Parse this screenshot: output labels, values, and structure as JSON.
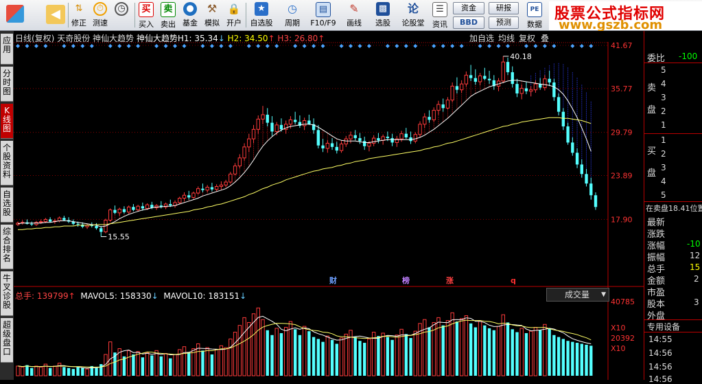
{
  "toolbar": {
    "buttons": [
      {
        "id": "back",
        "label": "",
        "icon": "back-arrow-icon"
      },
      {
        "id": "fix",
        "label": "修正",
        "icon": "up-down-arrow-icon"
      },
      {
        "id": "test",
        "label": "测速",
        "icon": "speed-icon"
      },
      {
        "id": "buy",
        "label": "买入",
        "icon": "buy-icon",
        "glyph": "买"
      },
      {
        "id": "sell",
        "label": "卖出",
        "icon": "sell-icon",
        "glyph": "卖"
      },
      {
        "id": "fund",
        "label": "基金",
        "icon": "fund-icon"
      },
      {
        "id": "sim",
        "label": "模拟",
        "icon": "hammer-icon"
      },
      {
        "id": "open",
        "label": "开户",
        "icon": "lock-icon"
      },
      {
        "id": "watch",
        "label": "自选股",
        "icon": "star-icon"
      },
      {
        "id": "period",
        "label": "周期",
        "icon": "clock-icon"
      },
      {
        "id": "f10",
        "label": "F10/F9",
        "icon": "f10-icon"
      },
      {
        "id": "draw",
        "label": "画线",
        "icon": "pencil-icon"
      },
      {
        "id": "pick",
        "label": "选股",
        "icon": "monitor-icon"
      },
      {
        "id": "forum",
        "label": "论股堂",
        "icon": "forum-icon",
        "glyph": "论"
      },
      {
        "id": "news",
        "label": "资讯",
        "icon": "news-icon"
      },
      {
        "id": "data",
        "label": "数据",
        "icon": "pe-icon",
        "glyph": "PE"
      }
    ],
    "small": {
      "funds": "资金",
      "bbd": "BBD",
      "research": "研报",
      "forecast": "预测"
    }
  },
  "brand": {
    "title": "股票公式指标网",
    "url": "www.gszb.com"
  },
  "left_tabs": [
    {
      "label": "应用",
      "active": false
    },
    {
      "label": "分时图",
      "active": false
    },
    {
      "label": "K线图",
      "active": true
    },
    {
      "label": "个股资料",
      "active": false
    },
    {
      "label": "自选股",
      "active": false
    },
    {
      "label": "综合排名",
      "active": false
    },
    {
      "label": "牛叉诊股",
      "active": false
    },
    {
      "label": "超级盘口",
      "active": false
    }
  ],
  "chart_head": {
    "period": "日线(复权)",
    "stock": "天奇股份",
    "indicator": "神仙大趋势",
    "h1_label": "神仙大趋势H1: 35.34",
    "h2_label": "H2: 34.50",
    "h3_label": "H3: 26.80",
    "tabs": [
      "加自选",
      "均线",
      "复权",
      "叠"
    ],
    "colors": {
      "h1": "#ffffff",
      "h2": "#ffff00",
      "h3": "#ff4040"
    }
  },
  "price_axis": {
    "labels": [
      "41.67",
      "35.77",
      "29.79",
      "23.89",
      "17.90"
    ]
  },
  "annotations": {
    "high": "40.18",
    "low": "15.55",
    "events": [
      {
        "text": "财",
        "color": "#6ea0ff"
      },
      {
        "text": "榜",
        "color": "#c080ff"
      },
      {
        "text": "涨",
        "color": "#ff4040"
      },
      {
        "text": "q",
        "color": "#ff3030"
      }
    ]
  },
  "volume_head": {
    "total": "总手: 139799",
    "mavol5": "MAVOL5: 158330",
    "mavol10": "MAVOL10: 183151",
    "dropdown": "成交量"
  },
  "volume_axis": {
    "labels": [
      "40785",
      "X10",
      "20392",
      "X10"
    ]
  },
  "right_panel": {
    "weibi_label": "委比",
    "weibi_value": "-100",
    "sell_label": "卖盘",
    "buy_label": "买盘",
    "sell_levels": [
      "5",
      "4",
      "3",
      "2",
      "1"
    ],
    "buy_levels": [
      "1",
      "2",
      "3",
      "4",
      "5"
    ],
    "status": "在卖盘18.41位置",
    "fields": [
      "最新",
      "涨跌",
      "涨幅",
      "振幅",
      "总手",
      "金额",
      "市盈",
      "股本",
      "外盘"
    ],
    "field_values": [
      "",
      "",
      "-10",
      "12",
      "15",
      "2",
      "",
      "3",
      ""
    ],
    "device": "专用设备",
    "times": [
      "14:55",
      "14:56",
      "14:56",
      "14:56"
    ]
  },
  "chart_data": {
    "type": "candlestick",
    "y_range": [
      15.5,
      41.67
    ],
    "candles": [
      [
        17.2,
        17.6,
        17.0,
        17.4
      ],
      [
        17.4,
        17.8,
        17.2,
        17.5
      ],
      [
        17.5,
        17.9,
        17.2,
        17.3
      ],
      [
        17.3,
        17.6,
        17.0,
        17.2
      ],
      [
        17.2,
        17.7,
        17.0,
        17.5
      ],
      [
        17.5,
        17.9,
        17.3,
        17.6
      ],
      [
        17.6,
        18.1,
        17.4,
        17.9
      ],
      [
        17.9,
        18.2,
        17.5,
        17.6
      ],
      [
        17.6,
        18.0,
        17.3,
        17.7
      ],
      [
        17.7,
        18.3,
        17.5,
        18.1
      ],
      [
        18.1,
        18.4,
        17.7,
        17.8
      ],
      [
        17.8,
        18.2,
        17.4,
        17.6
      ],
      [
        17.6,
        17.9,
        17.1,
        17.3
      ],
      [
        17.3,
        17.6,
        16.9,
        17.2
      ],
      [
        17.2,
        17.5,
        16.7,
        16.9
      ],
      [
        16.9,
        17.3,
        16.6,
        17.1
      ],
      [
        17.1,
        17.5,
        16.8,
        17.0
      ],
      [
        17.0,
        17.4,
        16.5,
        16.7
      ],
      [
        16.7,
        17.0,
        15.55,
        16.2
      ],
      [
        16.2,
        18.0,
        16.0,
        17.8
      ],
      [
        17.8,
        19.4,
        17.6,
        19.2
      ],
      [
        19.2,
        19.8,
        18.6,
        18.8
      ],
      [
        18.8,
        19.5,
        18.4,
        19.3
      ],
      [
        19.3,
        19.7,
        18.7,
        18.9
      ],
      [
        18.9,
        19.8,
        18.7,
        19.6
      ],
      [
        19.6,
        20.0,
        19.0,
        19.2
      ],
      [
        19.2,
        19.9,
        19.0,
        19.7
      ],
      [
        19.7,
        20.2,
        19.1,
        19.4
      ],
      [
        19.4,
        20.1,
        19.2,
        19.9
      ],
      [
        19.9,
        20.3,
        19.3,
        19.5
      ],
      [
        19.5,
        20.0,
        19.2,
        19.8
      ],
      [
        19.8,
        20.4,
        19.4,
        19.6
      ],
      [
        19.6,
        20.2,
        19.3,
        20.0
      ],
      [
        20.0,
        20.6,
        19.6,
        19.8
      ],
      [
        19.8,
        20.5,
        19.5,
        20.2
      ],
      [
        20.2,
        21.0,
        20.0,
        20.8
      ],
      [
        20.8,
        21.6,
        20.4,
        21.2
      ],
      [
        21.2,
        21.8,
        20.6,
        20.9
      ],
      [
        20.9,
        21.7,
        20.7,
        21.5
      ],
      [
        21.5,
        22.4,
        21.3,
        22.1
      ],
      [
        22.1,
        22.8,
        21.6,
        21.9
      ],
      [
        21.9,
        22.6,
        21.6,
        22.3
      ],
      [
        22.3,
        22.9,
        21.7,
        22.0
      ],
      [
        22.0,
        22.7,
        21.8,
        22.4
      ],
      [
        22.4,
        23.1,
        22.0,
        22.6
      ],
      [
        22.6,
        23.3,
        22.3,
        23.0
      ],
      [
        23.0,
        24.4,
        22.8,
        24.1
      ],
      [
        24.1,
        25.6,
        23.9,
        25.2
      ],
      [
        25.2,
        26.8,
        24.9,
        26.3
      ],
      [
        26.3,
        28.3,
        25.9,
        27.8
      ],
      [
        27.8,
        29.6,
        27.1,
        28.9
      ],
      [
        28.9,
        30.8,
        28.3,
        30.2
      ],
      [
        30.2,
        32.1,
        29.6,
        31.6
      ],
      [
        31.6,
        33.4,
        30.9,
        32.2
      ],
      [
        32.2,
        33.1,
        30.6,
        31.1
      ],
      [
        31.1,
        32.0,
        29.3,
        29.9
      ],
      [
        29.9,
        31.2,
        29.4,
        30.8
      ],
      [
        30.8,
        31.7,
        29.9,
        30.2
      ],
      [
        30.2,
        31.4,
        29.6,
        30.9
      ],
      [
        30.9,
        32.0,
        30.3,
        31.5
      ],
      [
        31.5,
        32.6,
        30.9,
        31.2
      ],
      [
        31.2,
        32.1,
        30.4,
        30.7
      ],
      [
        30.7,
        31.8,
        30.1,
        31.4
      ],
      [
        31.4,
        32.2,
        30.8,
        30.9
      ],
      [
        30.9,
        31.7,
        29.6,
        30.1
      ],
      [
        30.1,
        30.8,
        27.6,
        28.0
      ],
      [
        28.0,
        28.9,
        27.1,
        27.6
      ],
      [
        27.6,
        28.7,
        27.0,
        28.3
      ],
      [
        28.3,
        29.0,
        27.4,
        27.8
      ],
      [
        27.8,
        28.5,
        26.9,
        27.3
      ],
      [
        27.3,
        28.6,
        27.0,
        28.2
      ],
      [
        28.2,
        29.3,
        27.8,
        28.9
      ],
      [
        28.9,
        29.9,
        28.3,
        29.4
      ],
      [
        29.4,
        30.1,
        28.7,
        29.0
      ],
      [
        29.0,
        29.7,
        28.2,
        28.6
      ],
      [
        28.6,
        29.2,
        27.4,
        27.9
      ],
      [
        27.9,
        28.6,
        27.2,
        28.3
      ],
      [
        28.3,
        29.4,
        27.9,
        29.0
      ],
      [
        29.0,
        29.7,
        28.3,
        28.7
      ],
      [
        28.7,
        29.5,
        28.1,
        29.2
      ],
      [
        29.2,
        29.9,
        28.6,
        29.0
      ],
      [
        29.0,
        29.6,
        27.9,
        28.4
      ],
      [
        28.4,
        29.3,
        27.8,
        28.9
      ],
      [
        28.9,
        30.0,
        28.5,
        29.6
      ],
      [
        29.6,
        30.4,
        28.9,
        29.1
      ],
      [
        29.1,
        29.9,
        28.2,
        28.6
      ],
      [
        28.6,
        29.8,
        28.3,
        29.5
      ],
      [
        29.5,
        31.3,
        29.1,
        30.9
      ],
      [
        30.9,
        32.4,
        30.4,
        31.9
      ],
      [
        31.9,
        32.8,
        31.1,
        31.5
      ],
      [
        31.5,
        33.2,
        31.2,
        32.8
      ],
      [
        32.8,
        34.1,
        32.2,
        33.6
      ],
      [
        33.6,
        34.4,
        32.6,
        33.1
      ],
      [
        33.1,
        34.6,
        32.9,
        34.2
      ],
      [
        34.2,
        36.6,
        33.9,
        36.1
      ],
      [
        36.1,
        37.3,
        35.1,
        35.6
      ],
      [
        35.6,
        36.9,
        35.2,
        36.4
      ],
      [
        36.4,
        38.1,
        36.0,
        37.6
      ],
      [
        37.6,
        39.0,
        36.8,
        37.2
      ],
      [
        37.2,
        38.4,
        36.3,
        36.7
      ],
      [
        36.7,
        37.9,
        36.2,
        37.5
      ],
      [
        37.5,
        38.6,
        36.9,
        37.1
      ],
      [
        37.1,
        38.2,
        36.4,
        36.9
      ],
      [
        36.9,
        37.6,
        35.6,
        36.1
      ],
      [
        36.1,
        37.2,
        35.4,
        36.8
      ],
      [
        36.8,
        40.18,
        36.5,
        39.4
      ],
      [
        39.4,
        40.0,
        37.6,
        38.0
      ],
      [
        38.0,
        38.8,
        35.9,
        36.4
      ],
      [
        36.4,
        37.1,
        34.6,
        35.1
      ],
      [
        35.1,
        36.3,
        34.3,
        35.8
      ],
      [
        35.8,
        36.7,
        35.0,
        35.4
      ],
      [
        35.4,
        36.1,
        34.7,
        35.6
      ],
      [
        35.6,
        36.9,
        35.2,
        36.4
      ],
      [
        36.4,
        37.2,
        35.6,
        35.9
      ],
      [
        35.9,
        37.6,
        35.5,
        37.1
      ],
      [
        37.1,
        38.2,
        36.1,
        36.6
      ],
      [
        36.6,
        37.1,
        34.1,
        34.6
      ],
      [
        34.6,
        35.1,
        32.1,
        32.6
      ],
      [
        32.6,
        33.1,
        30.1,
        30.6
      ],
      [
        30.6,
        31.1,
        28.1,
        28.4
      ],
      [
        28.4,
        29.1,
        26.6,
        27.0
      ],
      [
        27.0,
        27.6,
        24.9,
        25.4
      ],
      [
        25.4,
        26.1,
        23.6,
        24.1
      ],
      [
        24.1,
        24.8,
        22.4,
        22.8
      ],
      [
        22.8,
        23.6,
        20.6,
        21.2
      ],
      [
        21.2,
        21.6,
        19.2,
        19.6
      ]
    ],
    "volumes": [
      10,
      9,
      11,
      8,
      10,
      9,
      12,
      8,
      10,
      13,
      9,
      8,
      7,
      9,
      8,
      7,
      10,
      8,
      12,
      22,
      35,
      24,
      28,
      20,
      26,
      22,
      25,
      19,
      24,
      21,
      26,
      20,
      23,
      18,
      22,
      27,
      30,
      24,
      28,
      33,
      26,
      29,
      22,
      27,
      31,
      29,
      38,
      45,
      52,
      60,
      55,
      64,
      70,
      58,
      47,
      42,
      49,
      44,
      50,
      56,
      48,
      42,
      51,
      46,
      40,
      38,
      35,
      41,
      37,
      33,
      39,
      43,
      47,
      40,
      36,
      34,
      38,
      45,
      41,
      44,
      40,
      37,
      42,
      48,
      43,
      39,
      46,
      54,
      58,
      50,
      55,
      60,
      52,
      57,
      65,
      56,
      59,
      62,
      54,
      50,
      56,
      52,
      49,
      47,
      51,
      63,
      55,
      48,
      45,
      49,
      44,
      46,
      50,
      47,
      53,
      49,
      42,
      40,
      38,
      36,
      35,
      34,
      33,
      32,
      31
    ],
    "ma_short": [
      17.3,
      17.4,
      17.4,
      17.4,
      17.4,
      17.4,
      17.5,
      17.5,
      17.6,
      17.7,
      17.7,
      17.7,
      17.6,
      17.5,
      17.4,
      17.3,
      17.2,
      17.1,
      16.9,
      17.0,
      17.3,
      17.6,
      18.0,
      18.3,
      18.6,
      18.8,
      19.0,
      19.2,
      19.3,
      19.5,
      19.6,
      19.6,
      19.7,
      19.7,
      19.8,
      20.0,
      20.2,
      20.4,
      20.6,
      20.8,
      21.1,
      21.3,
      21.5,
      21.7,
      21.9,
      22.1,
      22.5,
      23.0,
      23.6,
      24.3,
      25.1,
      26.0,
      27.0,
      27.9,
      28.6,
      29.2,
      29.7,
      30.1,
      30.4,
      30.6,
      30.7,
      30.8,
      30.9,
      30.9,
      30.8,
      30.5,
      30.1,
      29.7,
      29.3,
      28.9,
      28.7,
      28.6,
      28.6,
      28.6,
      28.5,
      28.4,
      28.4,
      28.5,
      28.6,
      28.7,
      28.8,
      28.8,
      28.8,
      28.8,
      28.8,
      28.8,
      28.9,
      29.1,
      29.4,
      29.8,
      30.2,
      30.7,
      31.2,
      31.7,
      32.3,
      32.9,
      33.5,
      34.1,
      34.7,
      35.1,
      35.4,
      35.7,
      36.0,
      36.2,
      36.4,
      36.6,
      36.8,
      36.9,
      36.9,
      36.8,
      36.7,
      36.6,
      36.5,
      36.4,
      36.3,
      36.2,
      36.0,
      35.6,
      35.0,
      34.1,
      33.0,
      31.8,
      30.4,
      28.9,
      27.2
    ],
    "ma_long": [
      16.5,
      16.5,
      16.6,
      16.6,
      16.7,
      16.7,
      16.8,
      16.8,
      16.9,
      16.9,
      17.0,
      17.0,
      17.0,
      17.1,
      17.1,
      17.1,
      17.1,
      17.2,
      17.2,
      17.2,
      17.3,
      17.4,
      17.5,
      17.6,
      17.7,
      17.8,
      17.9,
      18.0,
      18.1,
      18.2,
      18.3,
      18.4,
      18.5,
      18.6,
      18.7,
      18.8,
      18.9,
      19.0,
      19.2,
      19.3,
      19.4,
      19.6,
      19.7,
      19.9,
      20.0,
      20.2,
      20.4,
      20.6,
      20.8,
      21.0,
      21.3,
      21.5,
      21.8,
      22.1,
      22.3,
      22.6,
      22.8,
      23.0,
      23.3,
      23.5,
      23.7,
      23.9,
      24.1,
      24.3,
      24.5,
      24.6,
      24.8,
      24.9,
      25.0,
      25.2,
      25.3,
      25.5,
      25.6,
      25.8,
      25.9,
      26.0,
      26.2,
      26.3,
      26.4,
      26.5,
      26.6,
      26.7,
      26.8,
      26.9,
      27.0,
      27.1,
      27.2,
      27.3,
      27.5,
      27.6,
      27.8,
      27.9,
      28.1,
      28.3,
      28.4,
      28.6,
      28.8,
      29.0,
      29.2,
      29.4,
      29.6,
      29.8,
      30.0,
      30.2,
      30.4,
      30.6,
      30.7,
      30.9,
      31.0,
      31.2,
      31.3,
      31.4,
      31.5,
      31.6,
      31.7,
      31.8,
      31.8,
      31.8,
      31.7,
      31.7,
      31.6,
      31.5,
      31.4,
      31.2,
      31.0
    ]
  }
}
